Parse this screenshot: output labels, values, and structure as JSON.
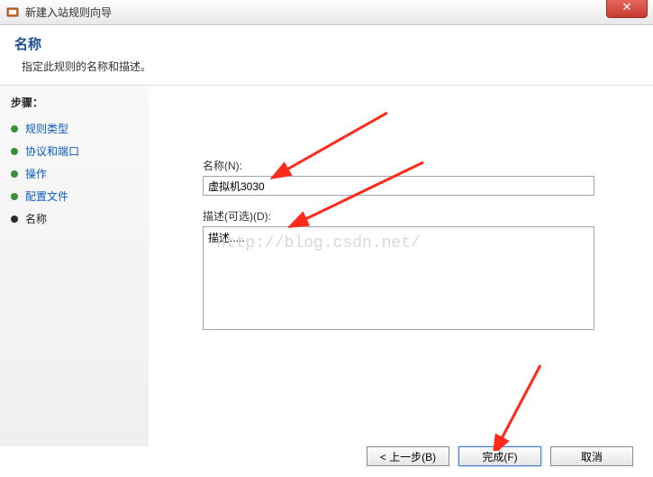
{
  "window": {
    "title": "新建入站规则向导",
    "close_glyph": "✕"
  },
  "header": {
    "title": "名称",
    "subtitle": "指定此规则的名称和描述。"
  },
  "sidebar": {
    "heading": "步骤：",
    "steps": [
      {
        "label": "规则类型",
        "type": "link"
      },
      {
        "label": "协议和端口",
        "type": "link"
      },
      {
        "label": "操作",
        "type": "link"
      },
      {
        "label": "配置文件",
        "type": "link"
      },
      {
        "label": "名称",
        "type": "active"
      }
    ]
  },
  "form": {
    "name_label": "名称(N):",
    "name_value": "虚拟机3030",
    "desc_label": "描述(可选)(D):",
    "desc_value": "描述....."
  },
  "watermark": "http://blog.csdn.net/",
  "buttons": {
    "back": "< 上一步(B)",
    "finish": "完成(F)",
    "cancel": "取消"
  },
  "arrow_color": "#ff2a1a"
}
